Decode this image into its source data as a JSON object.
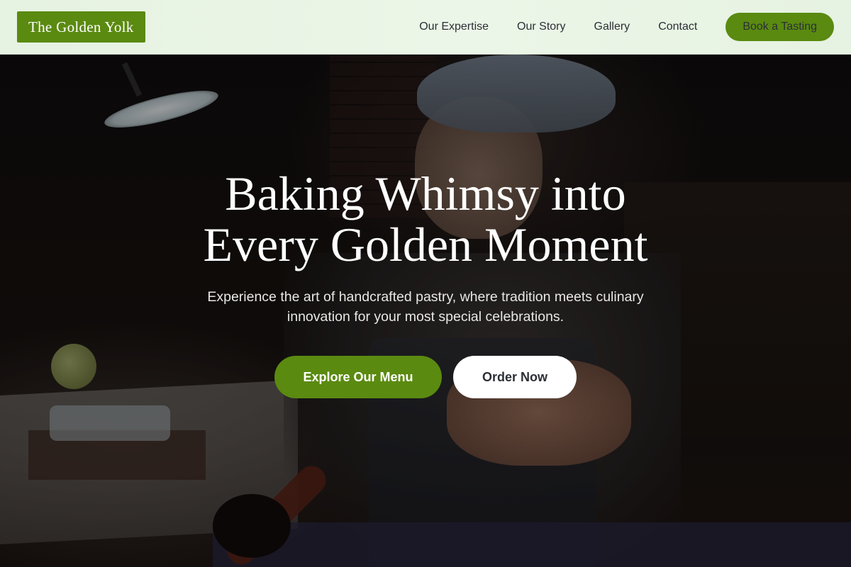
{
  "header": {
    "logo": "The Golden Yolk",
    "nav": [
      "Our Expertise",
      "Our Story",
      "Gallery",
      "Contact"
    ],
    "cta": "Book a Tasting"
  },
  "hero": {
    "title_line1": "Baking Whimsy into",
    "title_line2": "Every Golden Moment",
    "subtitle": "Experience the art of handcrafted pastry, where tradition meets culinary innovation for your most special celebrations.",
    "primary_button": "Explore Our Menu",
    "secondary_button": "Order Now"
  },
  "colors": {
    "brand_green": "#5a8a10",
    "header_bg": "#e6f2e2"
  }
}
